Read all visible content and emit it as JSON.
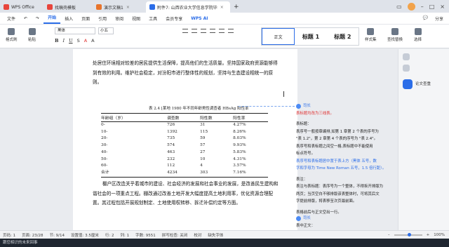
{
  "titlebar": {
    "tabs": [
      {
        "label": "WPS Office",
        "color": "#e8453c"
      },
      {
        "label": "找稿壳模板",
        "color": "#e8453c"
      },
      {
        "label": "演示文稿1",
        "color": "#e8742c"
      },
      {
        "label": "附件7: 山西农业大学信息学院毕",
        "color": "#2b6de8"
      }
    ],
    "new_tab": "+"
  },
  "menu": {
    "file": "文件",
    "items": [
      "开始",
      "插入",
      "页面",
      "引用",
      "审阅",
      "视图",
      "工具",
      "会员专享"
    ],
    "active": "开始",
    "ai": "WPS AI",
    "share": "分享"
  },
  "ribbon": {
    "format_painter": "格式刷",
    "paste": "粘贴",
    "font_name": "黑体",
    "font_size": "小五",
    "styles": [
      "正文",
      "标题 1",
      "标题 2"
    ],
    "style_set": "样式集",
    "find": "查找替换",
    "select": "选择"
  },
  "document": {
    "para1": "处居住环境相对较差的居民提供生活保障，提高他们的生活质量。坚持国家政府资源能够得到有效的利用。维护社会稳定，对汾阳市进行整体性的规划，坚持与生态建设相统一的原则。",
    "caption": "表 2.4 ⌊某地 1980 年不同年龄男性调查者 HBsAg 阳性率",
    "table": {
      "headers": [
        "年龄组（岁）",
        "调查数",
        "阳性数",
        "阳性率"
      ],
      "rows": [
        [
          "0-",
          "726",
          "31",
          "4.27%"
        ],
        [
          "10-",
          "1392",
          "115",
          "8.26%"
        ],
        [
          "20-",
          "735",
          "59",
          "8.03%"
        ],
        [
          "30-",
          "574",
          "57",
          "9.93%"
        ],
        [
          "40-",
          "463",
          "27",
          "5.83%"
        ],
        [
          "50-",
          "232",
          "10",
          "4.31%"
        ],
        [
          "60-",
          "112",
          "4",
          "3.57%"
        ],
        [
          "合计",
          "4234",
          "303",
          "7.16%"
        ]
      ]
    },
    "para2": "棚户区改造关乎着城市的建设、社会经济的发展和社会事业的发展，是改善民生建构和谐社会的一项重点工程。棚改通过改善土地开发大幅度提高土地利用率，优化资源合理配置。其过程包括开展规划制定、土地使用权转移、拆迁补偿约定等方面。"
  },
  "comments": [
    {
      "author": "司长",
      "lines": [
        {
          "text": "表标题均改为三线表。",
          "cls": "red"
        },
        {
          "text": "",
          "cls": ""
        },
        {
          "text": "表标题：",
          "cls": ""
        },
        {
          "text": "表序号一般按章编排,如第 1 章第 2 个表的序号为",
          "cls": ""
        },
        {
          "text": "\"表 1.2\"，第 2 章第 4 个表的序号为 \"表 2.4\"。",
          "cls": ""
        },
        {
          "text": "表序号和表标题之间空一格,表标题中不能使用",
          "cls": ""
        },
        {
          "text": "标点符号。",
          "cls": ""
        },
        {
          "text": "表序号和表标题居中置于表上方（黑体 五号，数",
          "cls": "blue"
        },
        {
          "text": "字和字母为 Time New Roman 五号，1.5 倍行距）。",
          "cls": "blue"
        },
        {
          "text": "",
          "cls": ""
        },
        {
          "text": "表注：",
          "cls": ""
        },
        {
          "text": "表注与表标题：表序号为一个整体，不得拆开排版为",
          "cls": ""
        },
        {
          "text": "两页；当页空白不够排版该表整体时，可将其后文",
          "cls": ""
        },
        {
          "text": "字提前排版，将表移至次页最前面。",
          "cls": ""
        },
        {
          "text": "",
          "cls": ""
        },
        {
          "text": "表格前后与正文空出一行。",
          "cls": ""
        }
      ]
    },
    {
      "author": "司长",
      "lines": [
        {
          "text": "表中正文：",
          "cls": ""
        }
      ]
    }
  ],
  "rail": {
    "assistant": "论文查重"
  },
  "status": {
    "page": "页码: 1",
    "pages": "页面: 23/28",
    "section": "节: 9/14",
    "setting": "设置值: 3.5厘米",
    "row": "行: 2",
    "col": "列: 1",
    "words": "字数: 9551",
    "spell": "拼写检查: 关闭",
    "check": "校对",
    "missing_font": "缺失字体",
    "zoom": "100%"
  },
  "taskbar": {
    "text": "跟您相识的未来回事"
  }
}
